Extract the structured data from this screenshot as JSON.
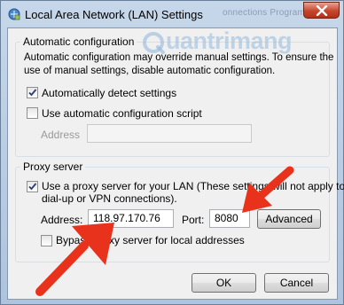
{
  "window": {
    "title": "Local Area Network (LAN) Settings",
    "background_tabs": "onnections   Program"
  },
  "watermark": {
    "text": "uantrimang"
  },
  "automatic_configuration": {
    "legend": "Automatic configuration",
    "description_line1": "Automatic configuration may override manual settings.  To ensure the",
    "description_line2": "use of manual settings, disable automatic configuration.",
    "detect_settings": {
      "label": "Automatically detect settings",
      "checked": true
    },
    "use_script": {
      "label": "Use automatic configuration script",
      "checked": false
    },
    "address": {
      "label": "Address",
      "value": ""
    }
  },
  "proxy_server": {
    "legend": "Proxy server",
    "use_proxy": {
      "label_line1": "Use a proxy server for your LAN (These settings will not apply to",
      "label_line2": "dial-up or VPN connections).",
      "checked": true
    },
    "address": {
      "label": "Address:",
      "value": "118.97.170.76"
    },
    "port": {
      "label": "Port:",
      "value": "8080"
    },
    "advanced_button": "Advanced",
    "bypass_local": {
      "label": "Bypass proxy server for local addresses",
      "checked": false
    }
  },
  "buttons": {
    "ok": "OK",
    "cancel": "Cancel"
  },
  "colors": {
    "arrow": "#e8321c",
    "accent": "#3399ff"
  }
}
